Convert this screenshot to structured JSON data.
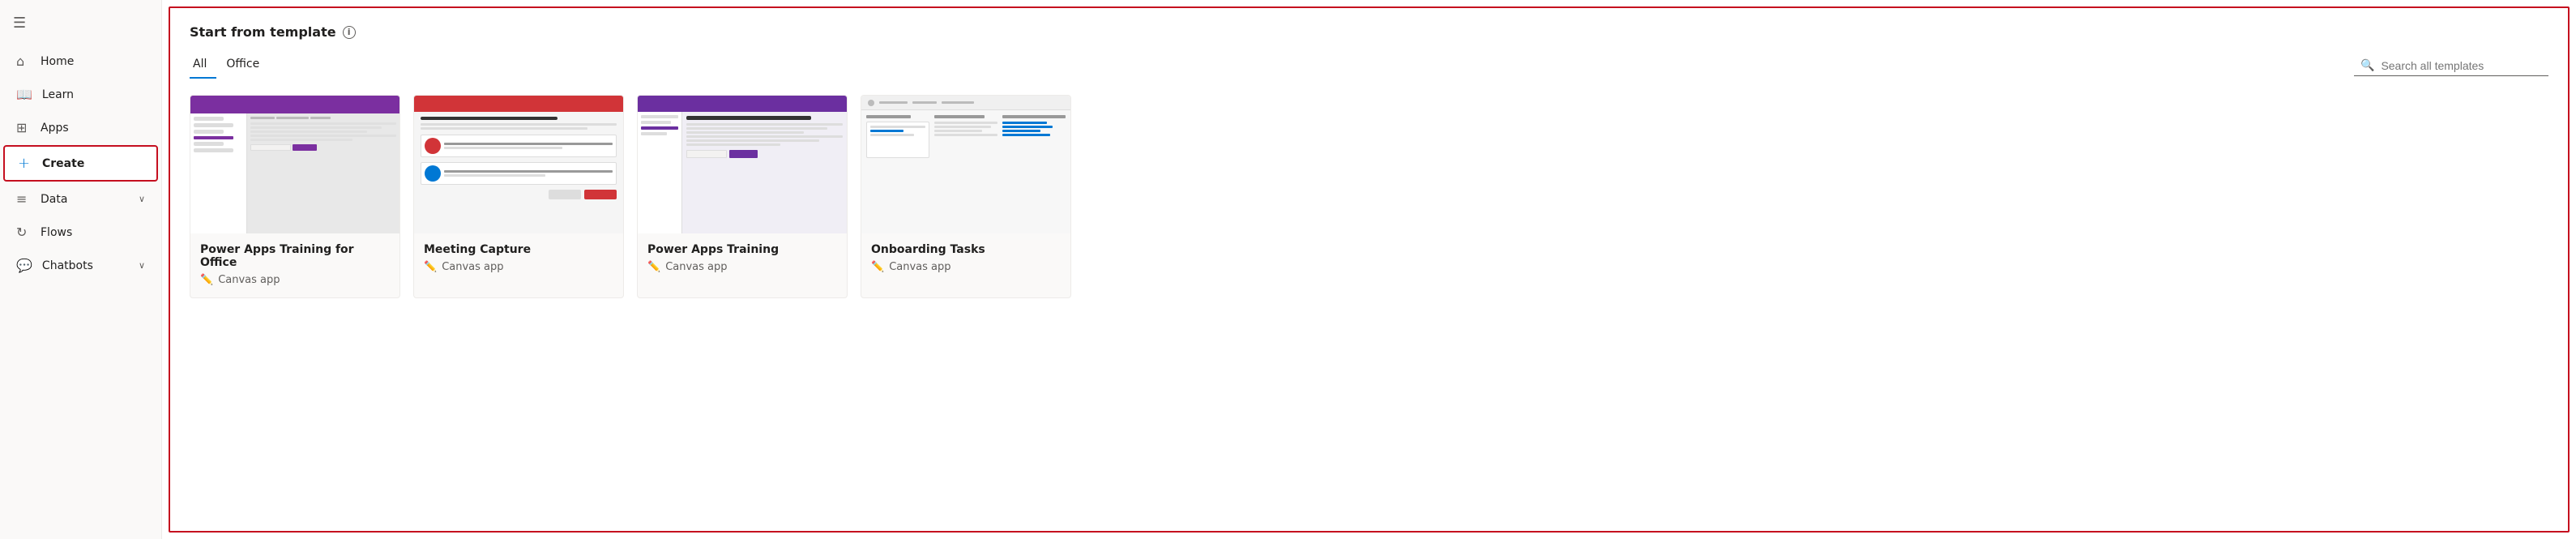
{
  "sidebar": {
    "items": [
      {
        "id": "hamburger",
        "label": "☰",
        "type": "icon"
      },
      {
        "id": "home",
        "label": "Home",
        "icon": "⌂"
      },
      {
        "id": "learn",
        "label": "Learn",
        "icon": "📖"
      },
      {
        "id": "apps",
        "label": "Apps",
        "icon": "⊞"
      },
      {
        "id": "create",
        "label": "Create",
        "icon": "+"
      },
      {
        "id": "data",
        "label": "Data",
        "icon": "≡",
        "hasChevron": true
      },
      {
        "id": "flows",
        "label": "Flows",
        "icon": "↻"
      },
      {
        "id": "chatbots",
        "label": "Chatbots",
        "icon": "💬",
        "hasChevron": true
      }
    ]
  },
  "main": {
    "section_title": "Start from template",
    "info_tooltip": "i",
    "tabs": [
      {
        "id": "all",
        "label": "All",
        "active": true
      },
      {
        "id": "office",
        "label": "Office",
        "active": false
      }
    ],
    "search_placeholder": "Search all templates",
    "cards": [
      {
        "id": "powerapps-office",
        "title": "Power Apps Training for Office",
        "type": "Canvas app",
        "preview_type": "powerapps-office"
      },
      {
        "id": "meeting-capture",
        "title": "Meeting Capture",
        "type": "Canvas app",
        "preview_type": "meeting-capture"
      },
      {
        "id": "powerapps-training",
        "title": "Power Apps Training",
        "type": "Canvas app",
        "preview_type": "powerapps-training"
      },
      {
        "id": "onboarding-tasks",
        "title": "Onboarding Tasks",
        "type": "Canvas app",
        "preview_type": "onboarding-tasks"
      }
    ]
  }
}
